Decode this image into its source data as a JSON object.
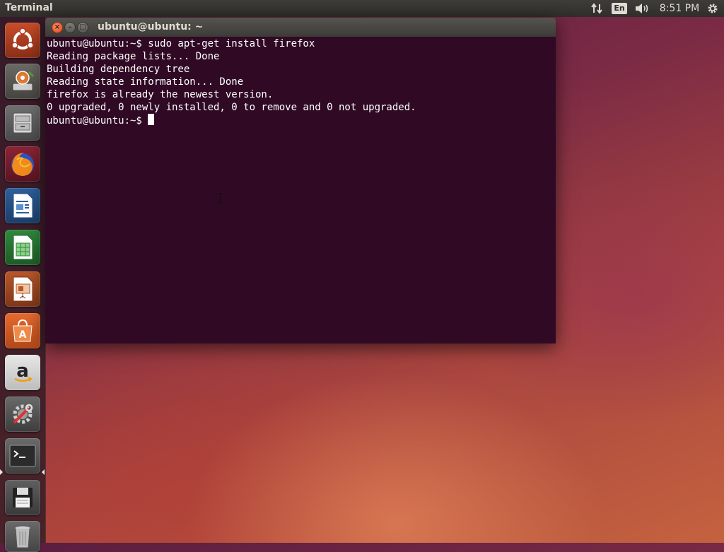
{
  "top_panel": {
    "app_title": "Terminal",
    "keyboard_layout": "En",
    "clock": "8:51 PM",
    "indicators": [
      "network-icon",
      "keyboard-indicator",
      "volume-icon",
      "clock",
      "session-gear-icon"
    ]
  },
  "launcher": {
    "items": [
      {
        "name": "dash-home",
        "icon": "ubuntu-logo-icon"
      },
      {
        "name": "install-ubuntu",
        "icon": "install-ubuntu-icon"
      },
      {
        "name": "files",
        "icon": "file-cabinet-icon"
      },
      {
        "name": "firefox",
        "icon": "firefox-icon"
      },
      {
        "name": "libreoffice-writer",
        "icon": "writer-icon"
      },
      {
        "name": "libreoffice-calc",
        "icon": "calc-icon"
      },
      {
        "name": "libreoffice-impress",
        "icon": "impress-icon"
      },
      {
        "name": "ubuntu-software",
        "icon": "software-center-icon"
      },
      {
        "name": "amazon",
        "icon": "amazon-icon"
      },
      {
        "name": "system-settings",
        "icon": "settings-icon"
      },
      {
        "name": "terminal",
        "icon": "terminal-icon",
        "running": true
      },
      {
        "name": "save",
        "icon": "floppy-disk-icon"
      },
      {
        "name": "trash",
        "icon": "trash-icon"
      }
    ]
  },
  "window": {
    "title": "ubuntu@ubuntu: ~",
    "buttons": [
      "close",
      "minimize",
      "maximize"
    ]
  },
  "terminal": {
    "lines": [
      "ubuntu@ubuntu:~$ sudo apt-get install firefox",
      "Reading package lists... Done",
      "Building dependency tree",
      "Reading state information... Done",
      "firefox is already the newest version.",
      "0 upgraded, 0 newly installed, 0 to remove and 0 not upgraded."
    ],
    "prompt": "ubuntu@ubuntu:~$"
  },
  "colors": {
    "terminal_bg": "#300a24",
    "terminal_fg": "#ffffff",
    "close_button": "#df4b1b",
    "panel_bg": "#3c3b37"
  }
}
